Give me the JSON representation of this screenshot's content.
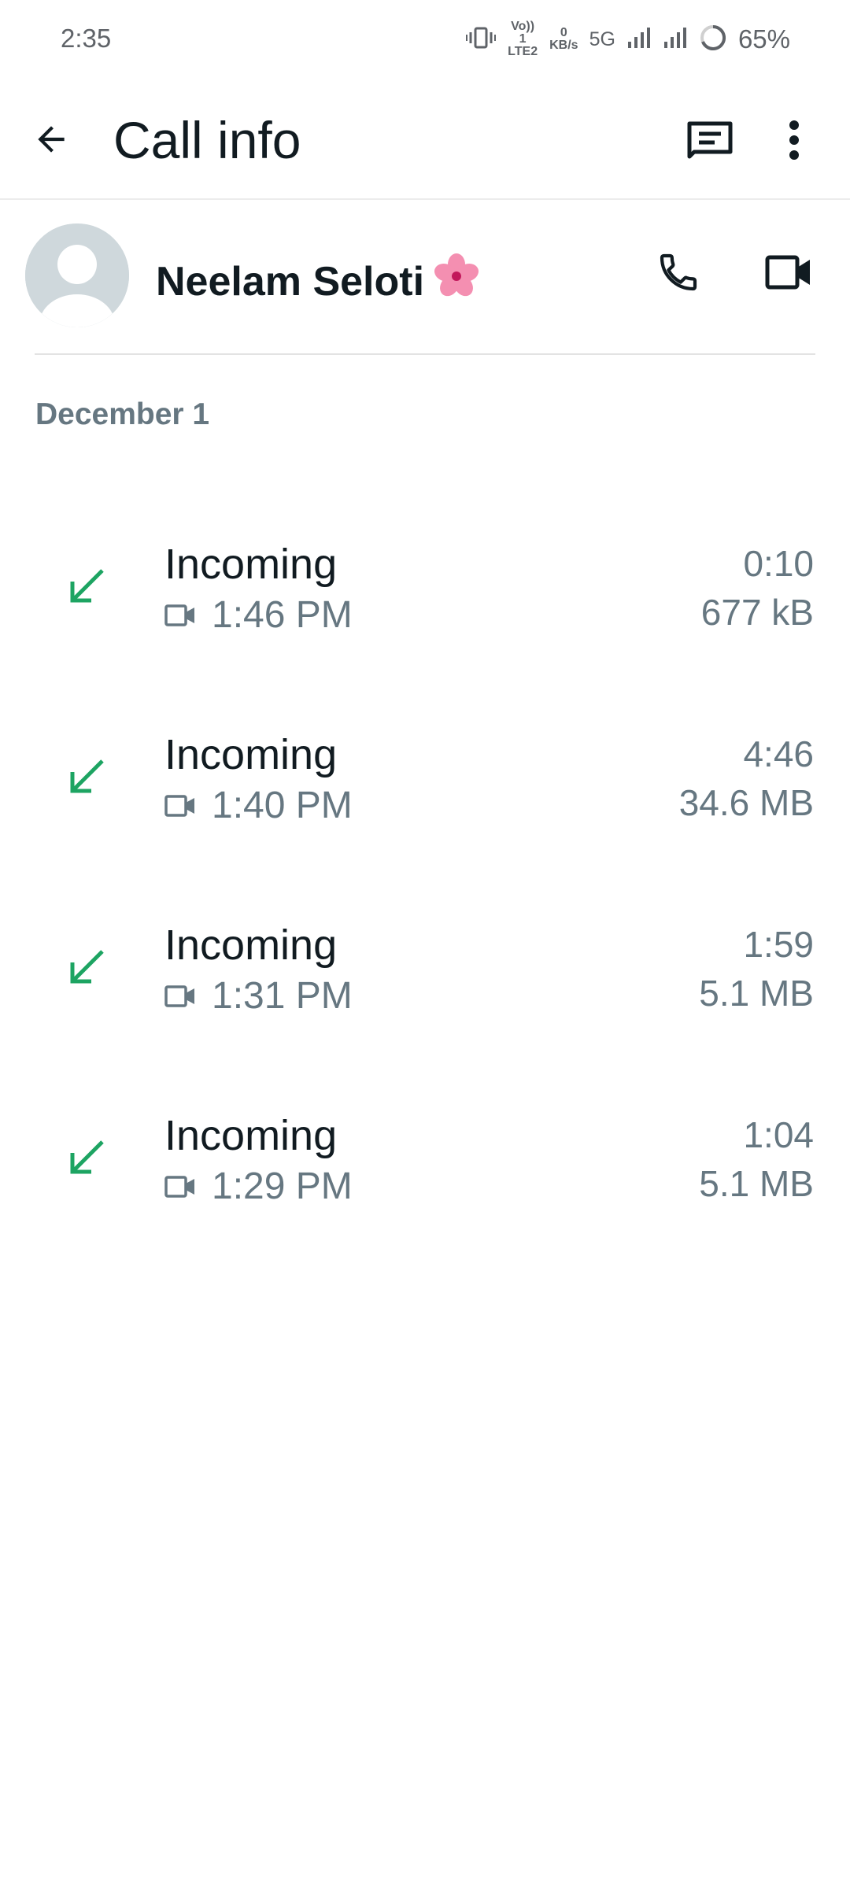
{
  "status_bar": {
    "time": "2:35",
    "volte_label": "Vo)) 1 LTE2",
    "speed_value": "0",
    "speed_unit": "KB/s",
    "network": "5G",
    "battery": "65%"
  },
  "app_bar": {
    "title": "Call info",
    "back_icon": "arrow-back-icon",
    "chat_icon": "message-icon",
    "menu_icon": "more-vert-icon"
  },
  "contact": {
    "name": "Neelam Seloti",
    "emoji": "🌸",
    "avatar_icon": "default-avatar-icon",
    "call_icon": "phone-icon",
    "video_icon": "videocam-icon"
  },
  "date_header": "December 1",
  "colors": {
    "incoming_arrow": "#1da462",
    "secondary_text": "#667781",
    "primary_text": "#111b21"
  },
  "calls": [
    {
      "type": "Incoming",
      "time": "1:46 PM",
      "duration": "0:10",
      "size": "677 kB",
      "direction_icon": "incoming-arrow-icon",
      "media_icon": "videocam-icon"
    },
    {
      "type": "Incoming",
      "time": "1:40 PM",
      "duration": "4:46",
      "size": "34.6 MB",
      "direction_icon": "incoming-arrow-icon",
      "media_icon": "videocam-icon"
    },
    {
      "type": "Incoming",
      "time": "1:31 PM",
      "duration": "1:59",
      "size": "5.1 MB",
      "direction_icon": "incoming-arrow-icon",
      "media_icon": "videocam-icon"
    },
    {
      "type": "Incoming",
      "time": "1:29 PM",
      "duration": "1:04",
      "size": "5.1 MB",
      "direction_icon": "incoming-arrow-icon",
      "media_icon": "videocam-icon"
    }
  ]
}
